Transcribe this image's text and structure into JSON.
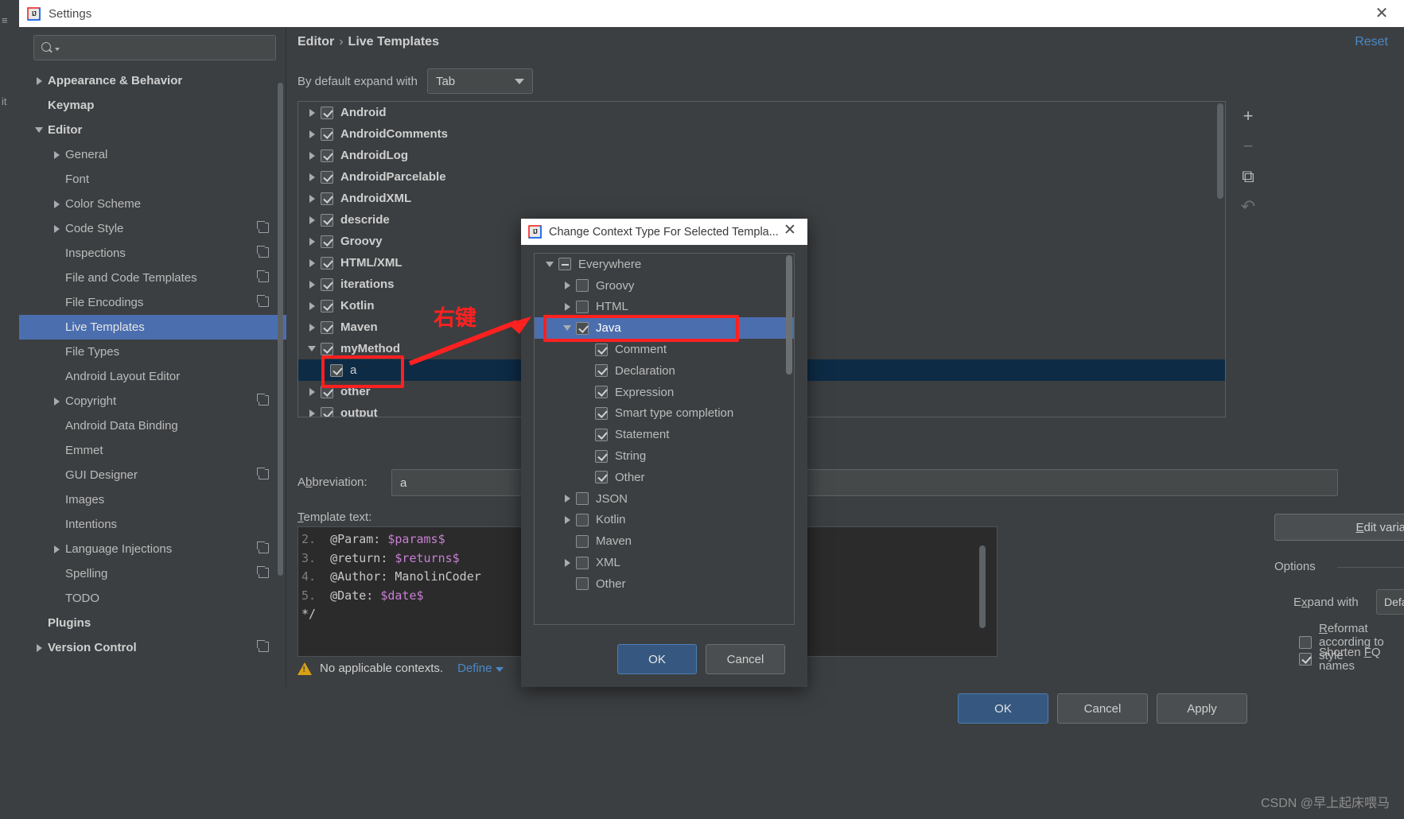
{
  "window": {
    "title": "Settings",
    "close_icon": "close-icon",
    "app_icon": "intellij-logo-icon"
  },
  "search": {
    "placeholder": "",
    "value": "",
    "icon": "search-icon"
  },
  "sidebar": {
    "items": [
      {
        "label": "Appearance & Behavior",
        "arrow": "right",
        "indent": 0,
        "bold": true,
        "badge": false,
        "selected": false
      },
      {
        "label": "Keymap",
        "arrow": "none",
        "indent": 0,
        "bold": true,
        "badge": false,
        "selected": false
      },
      {
        "label": "Editor",
        "arrow": "down",
        "indent": 0,
        "bold": true,
        "badge": false,
        "selected": false
      },
      {
        "label": "General",
        "arrow": "right",
        "indent": 1,
        "bold": false,
        "badge": false,
        "selected": false
      },
      {
        "label": "Font",
        "arrow": "none",
        "indent": 1,
        "bold": false,
        "badge": false,
        "selected": false
      },
      {
        "label": "Color Scheme",
        "arrow": "right",
        "indent": 1,
        "bold": false,
        "badge": false,
        "selected": false
      },
      {
        "label": "Code Style",
        "arrow": "right",
        "indent": 1,
        "bold": false,
        "badge": true,
        "selected": false
      },
      {
        "label": "Inspections",
        "arrow": "none",
        "indent": 1,
        "bold": false,
        "badge": true,
        "selected": false
      },
      {
        "label": "File and Code Templates",
        "arrow": "none",
        "indent": 1,
        "bold": false,
        "badge": true,
        "selected": false
      },
      {
        "label": "File Encodings",
        "arrow": "none",
        "indent": 1,
        "bold": false,
        "badge": true,
        "selected": false
      },
      {
        "label": "Live Templates",
        "arrow": "none",
        "indent": 1,
        "bold": false,
        "badge": false,
        "selected": true
      },
      {
        "label": "File Types",
        "arrow": "none",
        "indent": 1,
        "bold": false,
        "badge": false,
        "selected": false
      },
      {
        "label": "Android Layout Editor",
        "arrow": "none",
        "indent": 1,
        "bold": false,
        "badge": false,
        "selected": false
      },
      {
        "label": "Copyright",
        "arrow": "right",
        "indent": 1,
        "bold": false,
        "badge": true,
        "selected": false
      },
      {
        "label": "Android Data Binding",
        "arrow": "none",
        "indent": 1,
        "bold": false,
        "badge": false,
        "selected": false
      },
      {
        "label": "Emmet",
        "arrow": "none",
        "indent": 1,
        "bold": false,
        "badge": false,
        "selected": false
      },
      {
        "label": "GUI Designer",
        "arrow": "none",
        "indent": 1,
        "bold": false,
        "badge": true,
        "selected": false
      },
      {
        "label": "Images",
        "arrow": "none",
        "indent": 1,
        "bold": false,
        "badge": false,
        "selected": false
      },
      {
        "label": "Intentions",
        "arrow": "none",
        "indent": 1,
        "bold": false,
        "badge": false,
        "selected": false
      },
      {
        "label": "Language Injections",
        "arrow": "right",
        "indent": 1,
        "bold": false,
        "badge": true,
        "selected": false
      },
      {
        "label": "Spelling",
        "arrow": "none",
        "indent": 1,
        "bold": false,
        "badge": true,
        "selected": false
      },
      {
        "label": "TODO",
        "arrow": "none",
        "indent": 1,
        "bold": false,
        "badge": false,
        "selected": false
      },
      {
        "label": "Plugins",
        "arrow": "none",
        "indent": 0,
        "bold": true,
        "badge": false,
        "selected": false
      },
      {
        "label": "Version Control",
        "arrow": "right",
        "indent": 0,
        "bold": true,
        "badge": true,
        "selected": false
      }
    ],
    "help_label": "?"
  },
  "main": {
    "breadcrumb_root": "Editor",
    "breadcrumb_sep": "›",
    "breadcrumb_leaf": "Live Templates",
    "reset_label": "Reset",
    "expand_label": "By default expand with",
    "expand_value": "Tab",
    "templates": [
      {
        "label": "Android",
        "arrow": "right",
        "checked": true,
        "child": false,
        "selected": false
      },
      {
        "label": "AndroidComments",
        "arrow": "right",
        "checked": true,
        "child": false,
        "selected": false
      },
      {
        "label": "AndroidLog",
        "arrow": "right",
        "checked": true,
        "child": false,
        "selected": false
      },
      {
        "label": "AndroidParcelable",
        "arrow": "right",
        "checked": true,
        "child": false,
        "selected": false
      },
      {
        "label": "AndroidXML",
        "arrow": "right",
        "checked": true,
        "child": false,
        "selected": false
      },
      {
        "label": "descride",
        "arrow": "right",
        "checked": true,
        "child": false,
        "selected": false
      },
      {
        "label": "Groovy",
        "arrow": "right",
        "checked": true,
        "child": false,
        "selected": false
      },
      {
        "label": "HTML/XML",
        "arrow": "right",
        "checked": true,
        "child": false,
        "selected": false
      },
      {
        "label": "iterations",
        "arrow": "right",
        "checked": true,
        "child": false,
        "selected": false
      },
      {
        "label": "Kotlin",
        "arrow": "right",
        "checked": true,
        "child": false,
        "selected": false
      },
      {
        "label": "Maven",
        "arrow": "right",
        "checked": true,
        "child": false,
        "selected": false
      },
      {
        "label": "myMethod",
        "arrow": "down",
        "checked": true,
        "child": false,
        "selected": false
      },
      {
        "label": "a",
        "arrow": "none",
        "checked": true,
        "child": true,
        "selected": true
      },
      {
        "label": "other",
        "arrow": "right",
        "checked": true,
        "child": false,
        "selected": false
      },
      {
        "label": "output",
        "arrow": "right",
        "checked": true,
        "child": false,
        "selected": false
      }
    ],
    "toolbar": {
      "add": "+",
      "remove": "−",
      "copy": "⧉",
      "revert": "↶"
    },
    "abbreviation_label": "Abbreviation:",
    "abbreviation_value": "a",
    "template_text_label": "Template text:",
    "template_text_lines": [
      {
        "num": "2.",
        "prefix": " @Param: ",
        "var": "$params$",
        "suffix": ""
      },
      {
        "num": "3.",
        "prefix": " @return: ",
        "var": "$returns$",
        "suffix": ""
      },
      {
        "num": "4.",
        "prefix": " @Author: ",
        "var": "",
        "suffix": "ManolinCoder"
      },
      {
        "num": "5.",
        "prefix": " @Date: ",
        "var": "$date$",
        "suffix": ""
      }
    ],
    "template_text_last": "*/",
    "warning_text": "No applicable contexts.",
    "define_label": "Define",
    "edit_variables_label": "Edit variables",
    "options_legend": "Options",
    "expand_with_label": "Expand with",
    "expand_with_value": "Default (Tab)",
    "option_reformat": {
      "label": "Reformat according to style",
      "checked": false
    },
    "option_shorten": {
      "label": "Shorten FQ names",
      "checked": true
    },
    "ok_label": "OK",
    "cancel_label": "Cancel",
    "apply_label": "Apply"
  },
  "modal": {
    "title": "Change Context Type For Selected Templa...",
    "app_icon": "intellij-logo-icon",
    "close_icon": "close-icon",
    "contexts": [
      {
        "label": "Everywhere",
        "arrow": "down",
        "state": "indeterminate",
        "indent": 0,
        "selected": false
      },
      {
        "label": "Groovy",
        "arrow": "right",
        "state": "unchecked",
        "indent": 1,
        "selected": false
      },
      {
        "label": "HTML",
        "arrow": "right",
        "state": "unchecked",
        "indent": 1,
        "selected": false
      },
      {
        "label": "Java",
        "arrow": "down",
        "state": "checked",
        "indent": 1,
        "selected": true
      },
      {
        "label": "Comment",
        "arrow": "none",
        "state": "checked",
        "indent": 2,
        "selected": false
      },
      {
        "label": "Declaration",
        "arrow": "none",
        "state": "checked",
        "indent": 2,
        "selected": false
      },
      {
        "label": "Expression",
        "arrow": "none",
        "state": "checked",
        "indent": 2,
        "selected": false
      },
      {
        "label": "Smart type completion",
        "arrow": "none",
        "state": "checked",
        "indent": 2,
        "selected": false
      },
      {
        "label": "Statement",
        "arrow": "none",
        "state": "checked",
        "indent": 2,
        "selected": false
      },
      {
        "label": "String",
        "arrow": "none",
        "state": "checked",
        "indent": 2,
        "selected": false
      },
      {
        "label": "Other",
        "arrow": "none",
        "state": "checked",
        "indent": 2,
        "selected": false
      },
      {
        "label": "JSON",
        "arrow": "right",
        "state": "unchecked",
        "indent": 1,
        "selected": false
      },
      {
        "label": "Kotlin",
        "arrow": "right",
        "state": "unchecked",
        "indent": 1,
        "selected": false
      },
      {
        "label": "Maven",
        "arrow": "none",
        "state": "unchecked",
        "indent": 1,
        "selected": false
      },
      {
        "label": "XML",
        "arrow": "right",
        "state": "unchecked",
        "indent": 1,
        "selected": false
      },
      {
        "label": "Other",
        "arrow": "none",
        "state": "unchecked",
        "indent": 1,
        "selected": false
      }
    ],
    "ok_label": "OK",
    "cancel_label": "Cancel"
  },
  "annotations": {
    "right_click_text": "右键",
    "highlight_color": "#ff2020"
  },
  "watermark": "CSDN @早上起床喂马"
}
